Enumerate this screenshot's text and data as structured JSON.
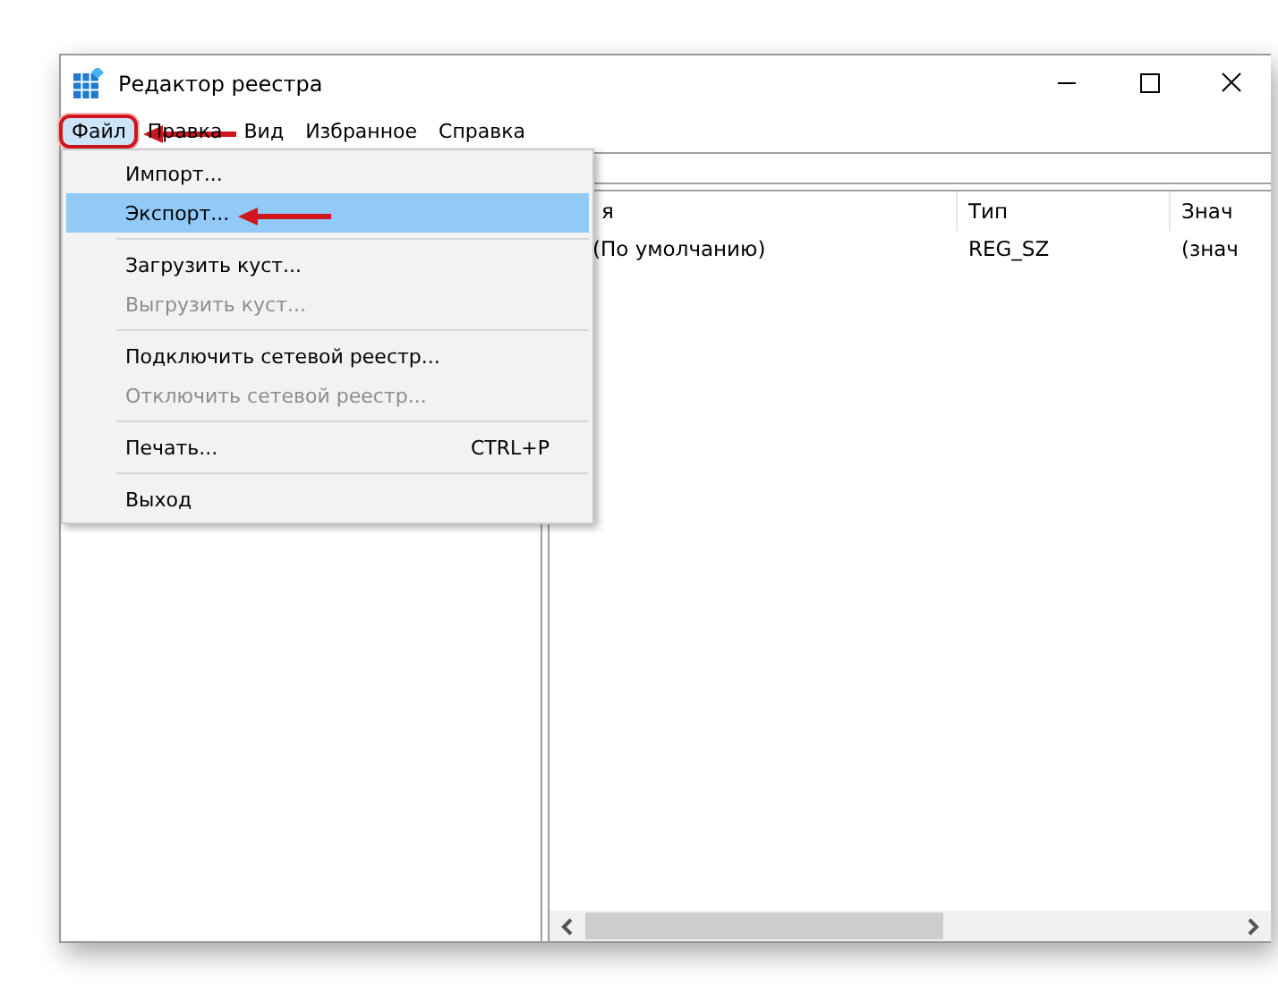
{
  "window": {
    "title": "Редактор реестра"
  },
  "menubar": [
    {
      "label": "Файл",
      "open": true,
      "annotated": true
    },
    {
      "label": "Правка",
      "open": false,
      "annotated": false
    },
    {
      "label": "Вид",
      "open": false,
      "annotated": false
    },
    {
      "label": "Избранное",
      "open": false,
      "annotated": false
    },
    {
      "label": "Справка",
      "open": false,
      "annotated": false
    }
  ],
  "file_menu": [
    {
      "kind": "item",
      "label": "Импорт...",
      "disabled": false,
      "selected": false,
      "annotated": false
    },
    {
      "kind": "item",
      "label": "Экспорт...",
      "disabled": false,
      "selected": true,
      "annotated": true
    },
    {
      "kind": "separator"
    },
    {
      "kind": "item",
      "label": "Загрузить куст...",
      "disabled": false,
      "selected": false,
      "annotated": false
    },
    {
      "kind": "item",
      "label": "Выгрузить куст...",
      "disabled": true,
      "selected": false,
      "annotated": false
    },
    {
      "kind": "separator"
    },
    {
      "kind": "item",
      "label": "Подключить сетевой реестр...",
      "disabled": false,
      "selected": false,
      "annotated": false
    },
    {
      "kind": "item",
      "label": "Отключить сетевой реестр...",
      "disabled": true,
      "selected": false,
      "annotated": false
    },
    {
      "kind": "separator"
    },
    {
      "kind": "item",
      "label": "Печать...",
      "shortcut": "CTRL+P",
      "disabled": false,
      "selected": false,
      "annotated": false
    },
    {
      "kind": "separator"
    },
    {
      "kind": "item",
      "label": "Выход",
      "disabled": false,
      "selected": false,
      "annotated": false
    }
  ],
  "table": {
    "columns": [
      "я",
      "Тип",
      "Знач"
    ],
    "rows": [
      {
        "cells": [
          "(По умолчанию)",
          "REG_SZ",
          "(знач"
        ]
      }
    ]
  }
}
